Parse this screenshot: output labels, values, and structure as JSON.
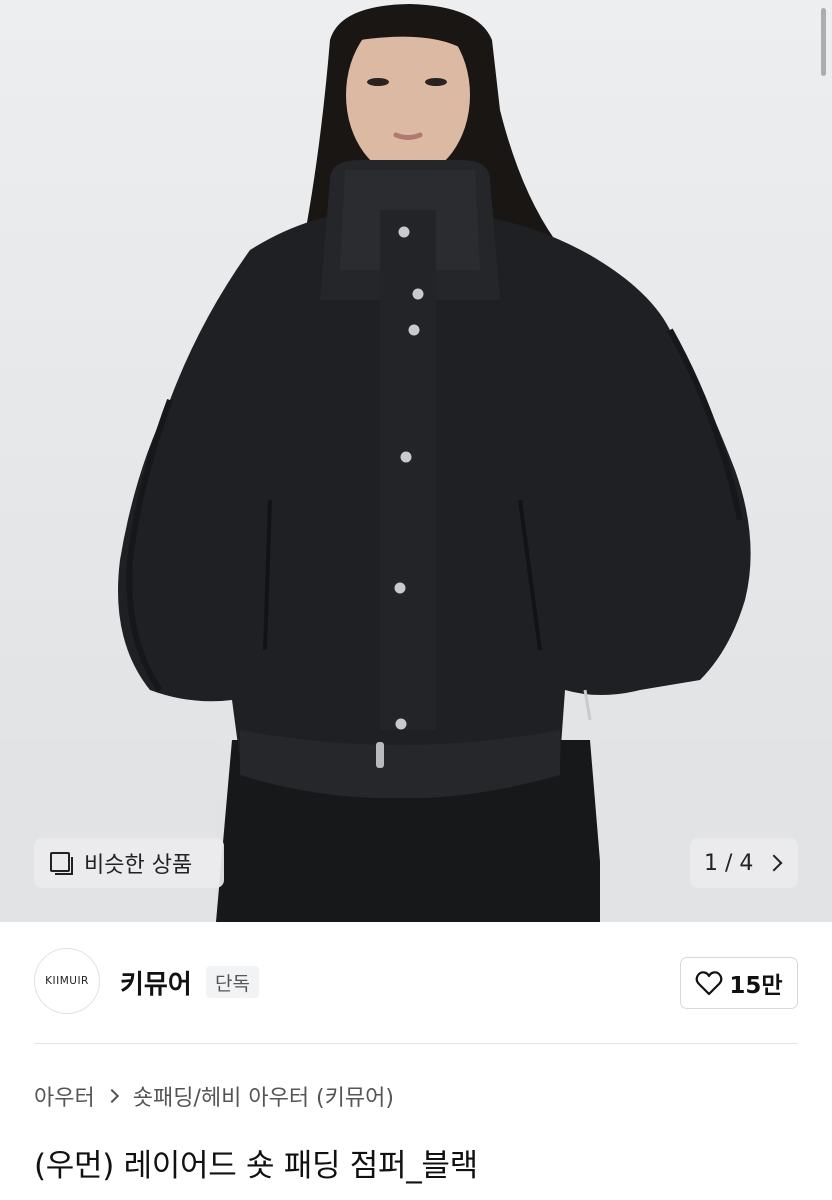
{
  "hero": {
    "similar_label": "비슷한 상품",
    "page_indicator": "1 / 4"
  },
  "brand": {
    "logo_text": "KIIMUIR",
    "name": "키뮤어",
    "badge": "단독",
    "likes": "15만"
  },
  "breadcrumb": {
    "category": "아우터",
    "subcategory": "숏패딩/헤비 아우터 (키뮤어)"
  },
  "product": {
    "title": "(우먼) 레이어드 숏 패딩 점퍼_블랙"
  },
  "colors": {
    "jacket": "#1e1f22",
    "background": "#e6e8ea",
    "skin": "#dcb9a3"
  }
}
